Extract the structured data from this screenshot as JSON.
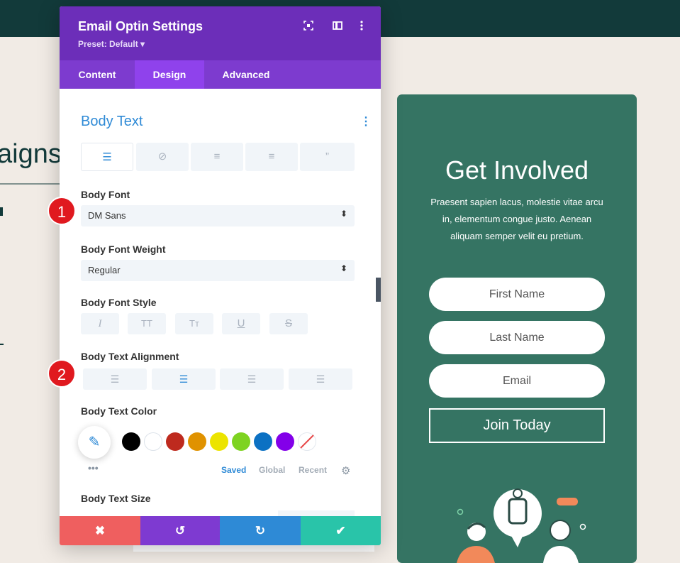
{
  "background": {
    "partial_heading": "aigns"
  },
  "card": {
    "title": "Get Involved",
    "description": "Praesent sapien lacus, molestie vitae arcu in, elementum congue justo. Aenean aliquam semper velit eu pretium.",
    "first_name_placeholder": "First Name",
    "last_name_placeholder": "Last Name",
    "email_placeholder": "Email",
    "button_label": "Join Today"
  },
  "panel": {
    "title": "Email Optin Settings",
    "preset": "Preset: Default ▾",
    "tabs": [
      "Content",
      "Design",
      "Advanced"
    ],
    "active_tab": "Design",
    "section_title": "Body Text",
    "body_font_label": "Body Font",
    "body_font_value": "DM Sans",
    "body_font_weight_label": "Body Font Weight",
    "body_font_weight_value": "Regular",
    "body_font_style_label": "Body Font Style",
    "body_text_alignment_label": "Body Text Alignment",
    "body_text_color_label": "Body Text Color",
    "color_tabs": [
      "Saved",
      "Global",
      "Recent"
    ],
    "body_text_size_label": "Body Text Size",
    "swatches": [
      "#000000",
      "#ffffff",
      "#be2a1e",
      "#e09200",
      "#ece400",
      "#7ed321",
      "#0c71c3",
      "#8300e9"
    ]
  },
  "badges": [
    "1",
    "2"
  ]
}
